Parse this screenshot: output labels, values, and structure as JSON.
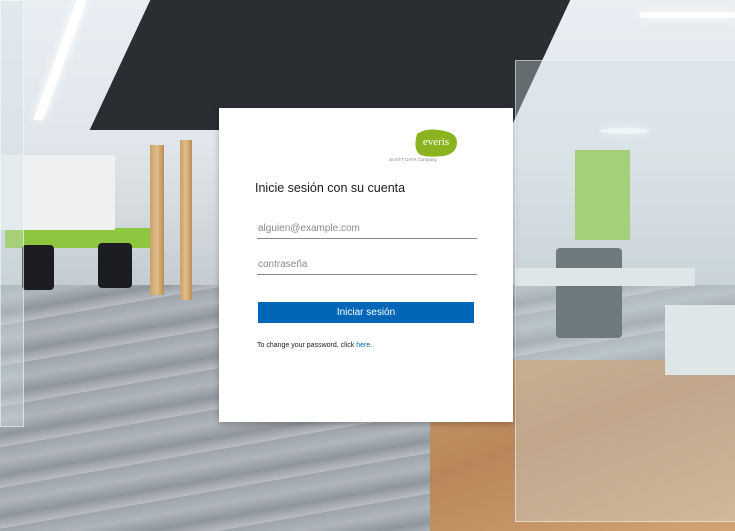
{
  "brand": {
    "logo_text": "everis",
    "tagline": "an NTT DATA Company",
    "color": "#8bb31f"
  },
  "login": {
    "title": "Inicie sesión con su cuenta",
    "email_placeholder": "alguien@example.com",
    "password_placeholder": "contraseña",
    "submit_label": "Iniciar sesión",
    "help_prefix": "To change your password, click ",
    "help_link": "here",
    "help_suffix": "."
  },
  "colors": {
    "button": "#0067b8",
    "link": "#0067b8"
  }
}
